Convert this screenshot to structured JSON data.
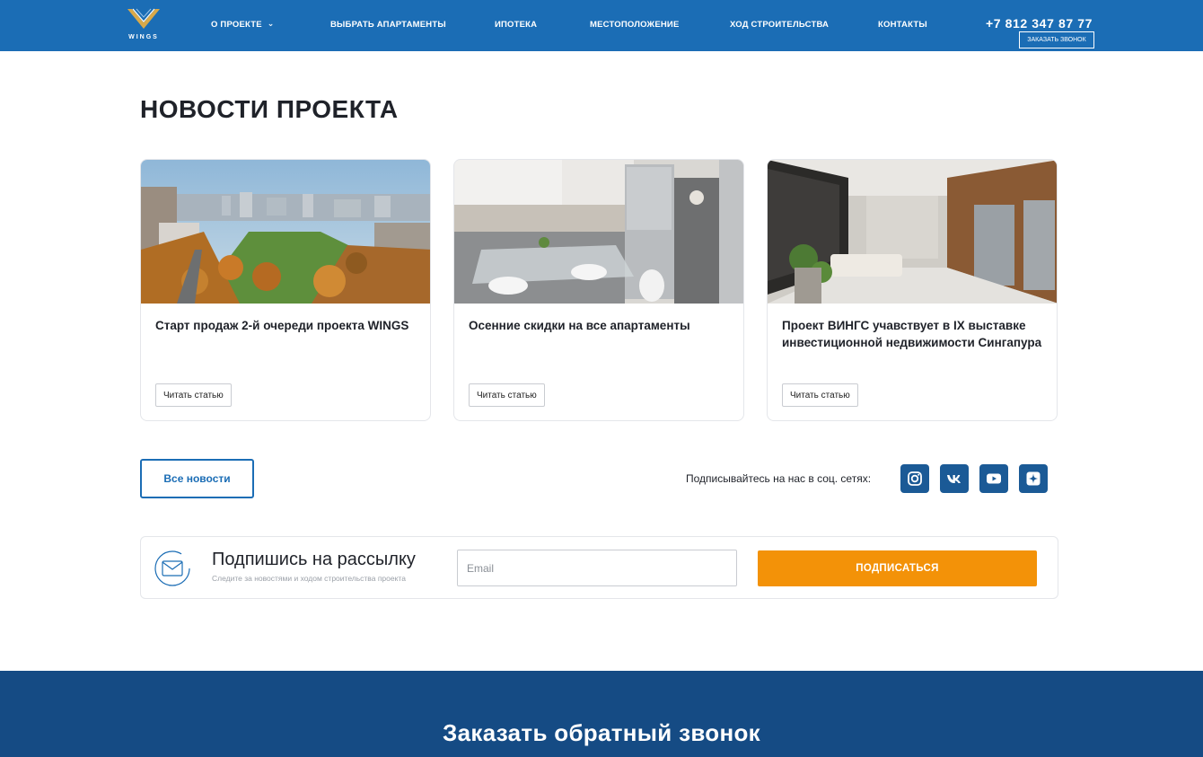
{
  "header": {
    "logo_text": "WINGS",
    "nav": [
      {
        "label": "О ПРОЕКТЕ",
        "has_dropdown": true
      },
      {
        "label": "ВЫБРАТЬ АПАРТАМЕНТЫ"
      },
      {
        "label": "ИПОТЕКА"
      },
      {
        "label": "МЕСТОПОЛОЖЕНИЕ"
      },
      {
        "label": "ХОД СТРОИТЕЛЬСТВА"
      },
      {
        "label": "КОНТАКТЫ"
      }
    ],
    "phone": "+7 812 347 87 77",
    "callback_label": "ЗАКАЗАТЬ ЗВОНОК",
    "colors": {
      "bg": "#1b6db5"
    }
  },
  "main": {
    "title": "НОВОСТИ ПРОЕКТА",
    "news": [
      {
        "title": "Старт продаж 2-й очереди проекта WINGS",
        "button": "Читать статью",
        "image": "city-autumn-park"
      },
      {
        "title": "Осенние скидки на все апартаменты",
        "button": "Читать статью",
        "image": "kitchen-interior"
      },
      {
        "title": "Проект ВИНГС учавствует в IX выставке инвестиционной недвижимости Сингапура",
        "button": "Читать статью",
        "image": "lobby-interior"
      }
    ],
    "all_news_label": "Все новости",
    "social_label": "Подписывайтесь на нас в соц. сетях:",
    "social": [
      "instagram-icon",
      "vk-icon",
      "youtube-icon",
      "yandex-zen-icon"
    ]
  },
  "subscribe": {
    "title": "Подпишись на рассылку",
    "description": "Следите за новостями и ходом строительства проекта",
    "email_placeholder": "Email",
    "button": "ПОДПИСАТЬСЯ",
    "accent": "#f39208"
  },
  "footer_band": {
    "title": "Заказать обратный звонок",
    "bg": "#154b84"
  }
}
